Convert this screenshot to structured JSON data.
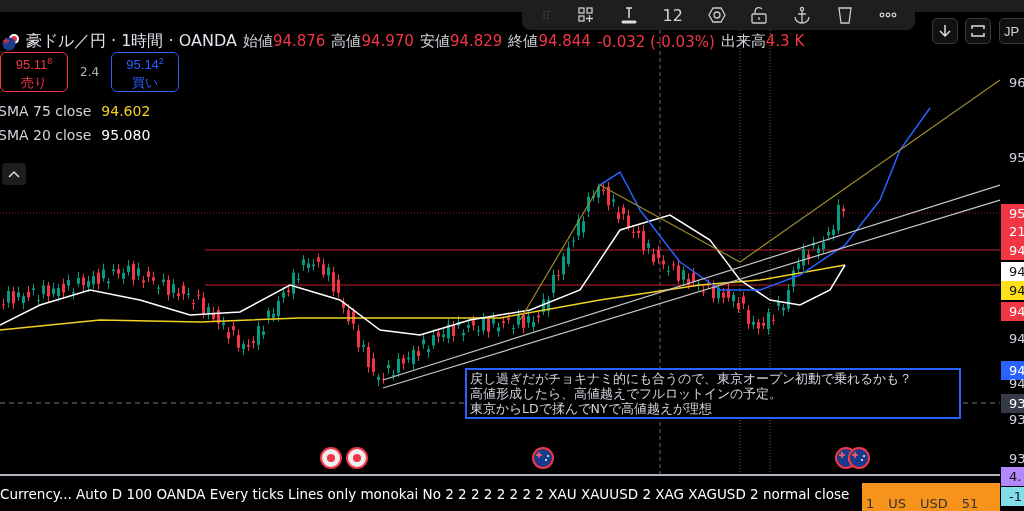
{
  "toolbar": {
    "value": "12"
  },
  "header": {
    "symbol_title": "豪ドル／円 · 1時間 · OANDA",
    "ohlc": [
      {
        "label": "始値",
        "value": "94.876"
      },
      {
        "label": "高値",
        "value": "94.970"
      },
      {
        "label": "安値",
        "value": "94.829"
      },
      {
        "label": "終値",
        "value": "94.844"
      }
    ],
    "change": "-0.032 (-0.03%)",
    "volume": {
      "label": "出来高",
      "value": "4.3 K"
    }
  },
  "right_buttons": {
    "currency": "JP"
  },
  "trade": {
    "sell": {
      "price": "95.11$^{8}$",
      "label": "売り"
    },
    "spread": "2.4",
    "buy": {
      "price": "95.14$^{2}$",
      "label": "買い"
    }
  },
  "indicators": [
    {
      "name": "SMA 75 close",
      "value": "94.602",
      "color": "#f2d024"
    },
    {
      "name": "SMA 20 close",
      "value": "95.080",
      "color": "#ffffff"
    }
  ],
  "annotation": {
    "lines": [
      "戻し過ぎだがチョキナミ的にも合うので、東京オープン初動で乗れるかも？",
      "高値形成したら、高値越えでフルロットインの予定。",
      "東京からLDで揉んでNYで高値越えが理想"
    ]
  },
  "events": [
    {
      "kind": "dot"
    },
    {
      "kind": "dot"
    },
    {
      "kind": "flag"
    },
    {
      "kind": "flag"
    },
    {
      "kind": "flag"
    }
  ],
  "price_axis": [
    {
      "text": "96",
      "kind": "plain"
    },
    {
      "text": "95",
      "kind": "plain"
    },
    {
      "text": "95",
      "kind": "tag",
      "color": "#f23645"
    },
    {
      "text": "21",
      "kind": "tag",
      "color": "#f23645"
    },
    {
      "text": "94",
      "kind": "tag",
      "color": "#f23645"
    },
    {
      "text": "94",
      "kind": "tag",
      "color": "#ffffff"
    },
    {
      "text": "94",
      "kind": "tag",
      "color": "#ffe11a"
    },
    {
      "text": "94",
      "kind": "tag",
      "color": "#f23645"
    },
    {
      "text": "94",
      "kind": "plain"
    },
    {
      "text": "94",
      "kind": "tag",
      "color": "#2962ff"
    },
    {
      "text": "94",
      "kind": "plain"
    },
    {
      "text": "93",
      "kind": "tag",
      "color": "#363a45"
    },
    {
      "text": "93",
      "kind": "plain"
    },
    {
      "text": "93",
      "kind": "plain"
    },
    {
      "text": "4.",
      "kind": "tag",
      "color": "#b388ff"
    },
    {
      "text": "-1",
      "kind": "tag",
      "color": "#80deea"
    }
  ],
  "status_bar": {
    "text": "Currency... Auto D 100 OANDA Every ticks Lines only monokai No 2 2 2 2 2 2 2 2 XAU XAUUSD 2 XAG XAGUSD 2 normal close"
  },
  "watchlist_row": {
    "cells": [
      "1",
      "US",
      "USD",
      "51"
    ]
  }
}
